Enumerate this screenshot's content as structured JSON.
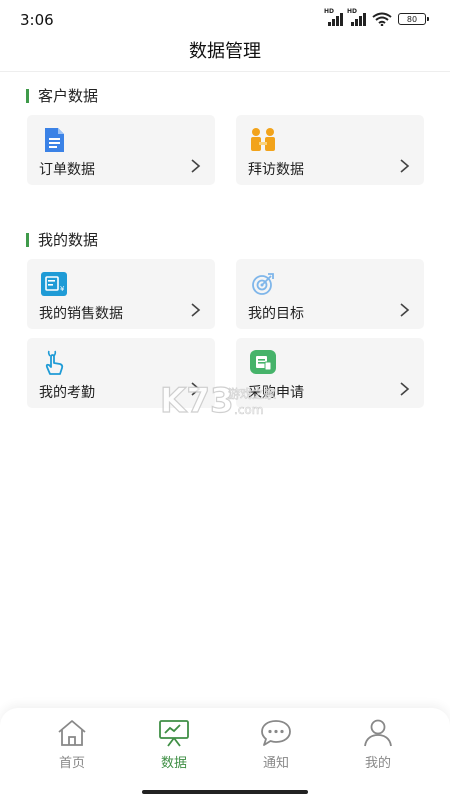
{
  "status_bar": {
    "time": "3:06",
    "battery": "80"
  },
  "header": {
    "title": "数据管理"
  },
  "sections": [
    {
      "title": "客户数据",
      "cards": [
        {
          "label": "订单数据",
          "icon": "document-icon"
        },
        {
          "label": "拜访数据",
          "icon": "visit-icon"
        }
      ]
    },
    {
      "title": "我的数据",
      "cards": [
        {
          "label": "我的销售数据",
          "icon": "sales-icon"
        },
        {
          "label": "我的目标",
          "icon": "target-icon"
        },
        {
          "label": "我的考勤",
          "icon": "tap-hand-icon"
        },
        {
          "label": "采购申请",
          "icon": "purchase-icon"
        }
      ]
    }
  ],
  "tabs": [
    {
      "label": "首页",
      "icon": "home-icon",
      "active": false
    },
    {
      "label": "数据",
      "icon": "presentation-icon",
      "active": true
    },
    {
      "label": "通知",
      "icon": "chat-bubble-icon",
      "active": false
    },
    {
      "label": "我的",
      "icon": "person-icon",
      "active": false
    }
  ],
  "colors": {
    "accent": "#3f9a4a",
    "card_bg": "#f5f5f5",
    "blue": "#3b82e6",
    "orange": "#f2a31b",
    "teal": "#1f9bd6",
    "green": "#46b36a"
  }
}
